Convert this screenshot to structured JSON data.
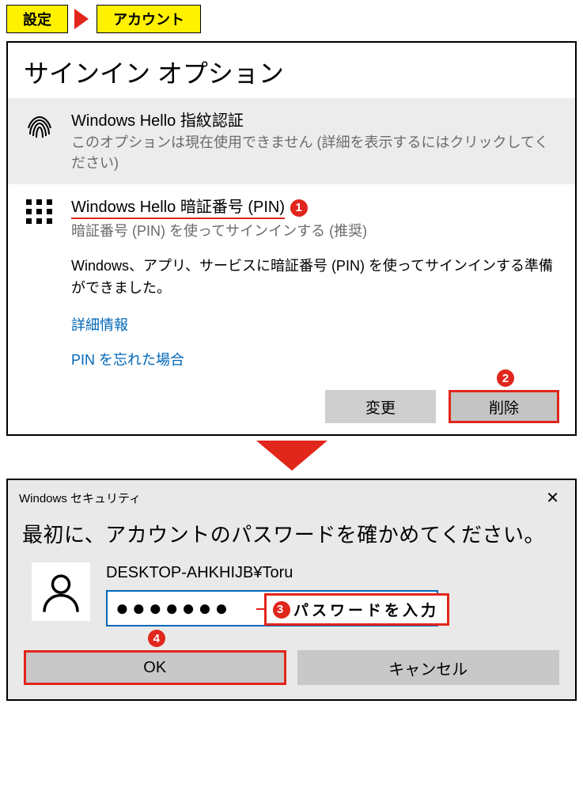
{
  "breadcrumb": {
    "item1": "設定",
    "item2": "アカウント"
  },
  "panel": {
    "title": "サインイン オプション",
    "fingerprint": {
      "title": "Windows Hello 指紋認証",
      "sub": "このオプションは現在使用できません (詳細を表示するにはクリックしてください)"
    },
    "pin": {
      "title": "Windows Hello 暗証番号 (PIN)",
      "sub": "暗証番号 (PIN) を使ってサインインする (推奨)",
      "desc": "Windows、アプリ、サービスに暗証番号 (PIN) を使ってサインインする準備ができました。",
      "link_more": "詳細情報",
      "link_forgot": "PIN を忘れた場合",
      "btn_change": "変更",
      "btn_remove": "削除"
    }
  },
  "dialog": {
    "title": "Windows セキュリティ",
    "message": "最初に、アカウントのパスワードを確かめてください。",
    "account": "DESKTOP-AHKHIJB¥Toru",
    "password_mask": "●●●●●●●",
    "callout": "パスワードを入力",
    "ok": "OK",
    "cancel": "キャンセル"
  },
  "callouts": {
    "n1": "1",
    "n2": "2",
    "n3": "3",
    "n4": "4"
  }
}
